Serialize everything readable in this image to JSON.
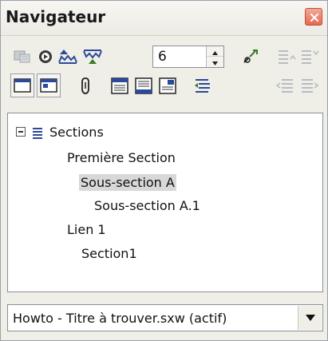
{
  "window": {
    "title": "Navigateur",
    "close_icon": "close-icon"
  },
  "toolbar": {
    "row1": [
      "toggle-content-icon",
      "navigation-icon",
      "previous-icon",
      "next-icon"
    ],
    "spin_value": "6",
    "row1_right": [
      "drag-mode-icon",
      "promote-level-icon",
      "demote-level-icon"
    ],
    "row2": [
      "content-view-icon",
      "list-box-icon",
      "reminder-icon",
      "header-icon",
      "footer-icon",
      "anchor-note-icon",
      "heading-levels-icon",
      "promote-chapter-icon",
      "demote-chapter-icon"
    ]
  },
  "tree": {
    "root_label": "Sections",
    "items": [
      {
        "label": "Première Section",
        "selected": false
      },
      {
        "label": "Sous-section A",
        "selected": true
      },
      {
        "label": "Sous-section A.1",
        "selected": false
      },
      {
        "label": "Lien 1",
        "selected": false
      },
      {
        "label": "Section1",
        "selected": false
      }
    ]
  },
  "document_select": {
    "value": "Howto - Titre à trouver.sxw (actif)"
  },
  "colors": {
    "background": "#efeee7",
    "close_button": "#e46a50",
    "selection": "#d8d8d8",
    "icon_blue": "#2c4a9a",
    "icon_green": "#3a7a2a",
    "icon_gray": "#b8bcc2"
  }
}
